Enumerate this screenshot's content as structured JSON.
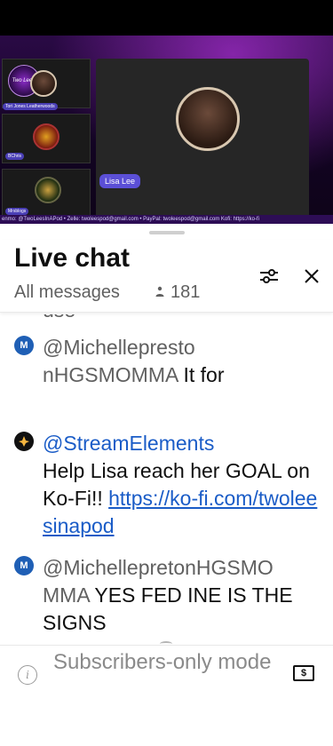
{
  "video": {
    "logo_text": "Two Lee's",
    "host_label": "Lisa Lee",
    "cam_labels": [
      "Tori Jones Leatherwoods",
      "BChris",
      "Mrsblogs"
    ],
    "ticker": "enmo: @TwoLeesInAPod • Zelle: twoleespod@gmail.com • PayPal: twoleespod@gmail.com Kofi: https://ko-fi"
  },
  "chat": {
    "title": "Live chat",
    "filter_label": "All messages",
    "viewer_count": "181",
    "partial_top_text": "use",
    "messages": [
      {
        "avatar_letter": "M",
        "avatar_color": "#1f5fb5",
        "author": "@MichellepretonHGSMOMMA",
        "author_display": "@Michellepresto nHGSMOMMA",
        "text": " It for"
      },
      {
        "avatar_letter": "",
        "avatar_color": "#111111",
        "author": "@StreamElements",
        "text": "Help Lisa reach her GOAL on Ko-Fi!! ",
        "link": "https://ko-fi.com/twoleesinapod"
      },
      {
        "avatar_letter": "M",
        "avatar_color": "#1f5fb5",
        "author": "@MichellepretonHGSMOMMA",
        "author_display": "@MichellepretonHGSMO MMA",
        "text": " YES FED INE IS THE SIGNS"
      }
    ]
  },
  "footer": {
    "mode_text": "Subscribers-only mode",
    "info_icon": "info-icon",
    "money_icon": "super-chat-icon"
  },
  "colors": {
    "accent_blue": "#1a5cc7",
    "text_primary": "#0f0f0f",
    "text_secondary": "#606060"
  }
}
